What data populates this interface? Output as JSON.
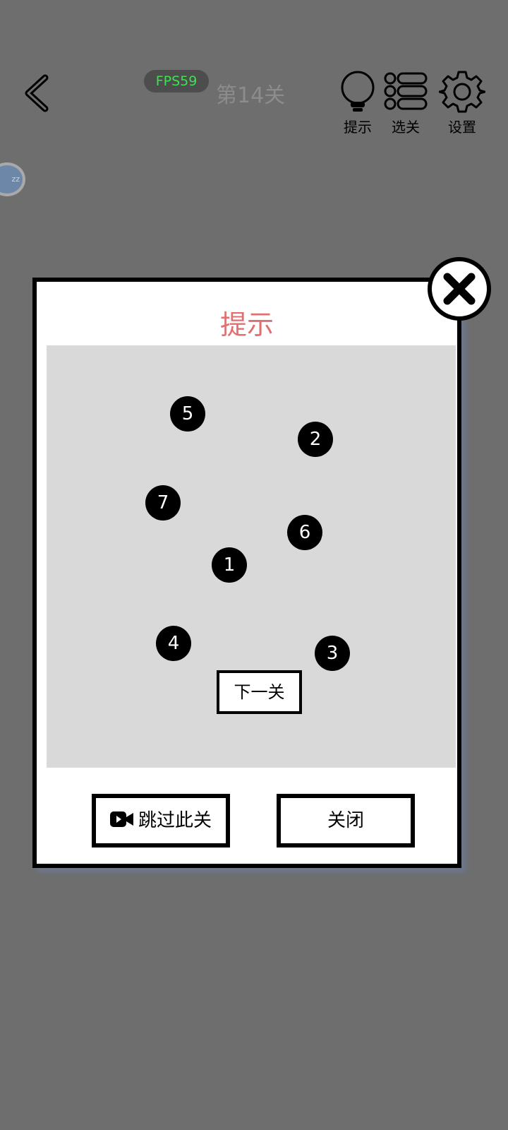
{
  "top_bar": {
    "fps": "FPS59",
    "level": "第14关",
    "tools": [
      {
        "label": "提示",
        "icon": "lightbulb-icon"
      },
      {
        "label": "选关",
        "icon": "list-icon"
      },
      {
        "label": "设置",
        "icon": "gear-icon"
      }
    ],
    "side_badge": "zz"
  },
  "dialog": {
    "title": "提示",
    "dots": [
      "5",
      "2",
      "7",
      "6",
      "1",
      "4",
      "3"
    ],
    "next_label": "下一关",
    "skip_label": "跳过此关",
    "close_label": "关闭"
  },
  "colors": {
    "background": "#6e6e6e",
    "fps_text": "#3fe052",
    "dialog_title": "#e07070",
    "hint_area": "#d9d9d9"
  }
}
